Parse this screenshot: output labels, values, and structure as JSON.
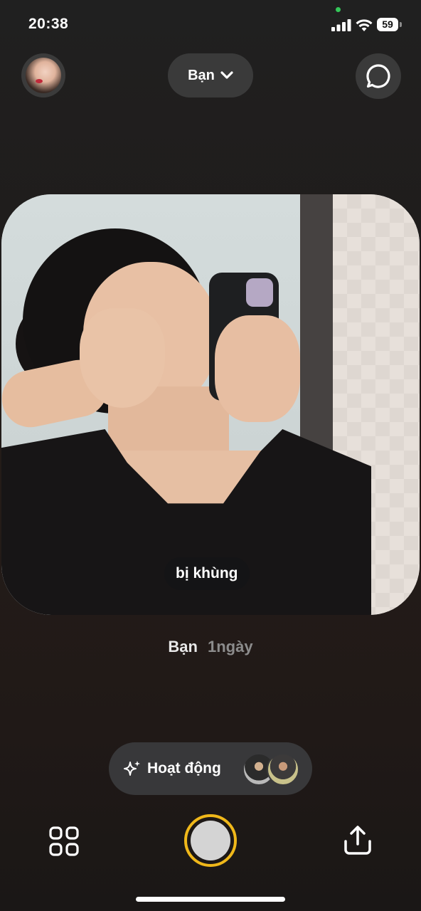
{
  "status_bar": {
    "time": "20:38",
    "battery": "59",
    "icons": [
      "signal-icon",
      "wifi-icon",
      "battery-icon"
    ]
  },
  "top_bar": {
    "friends_label": "Bạn",
    "icons": [
      "avatar",
      "chevron-down-icon",
      "chat-bubble-icon"
    ]
  },
  "post": {
    "caption": "bị khùng",
    "author": "Bạn",
    "time_ago": "1ngày"
  },
  "activity": {
    "label": "Hoạt động",
    "icon": "sparkles-icon"
  },
  "bottom_bar": {
    "icons": [
      "grid-icon",
      "shutter-button",
      "share-icon"
    ],
    "shutter_ring_color": "#f0b81a"
  }
}
